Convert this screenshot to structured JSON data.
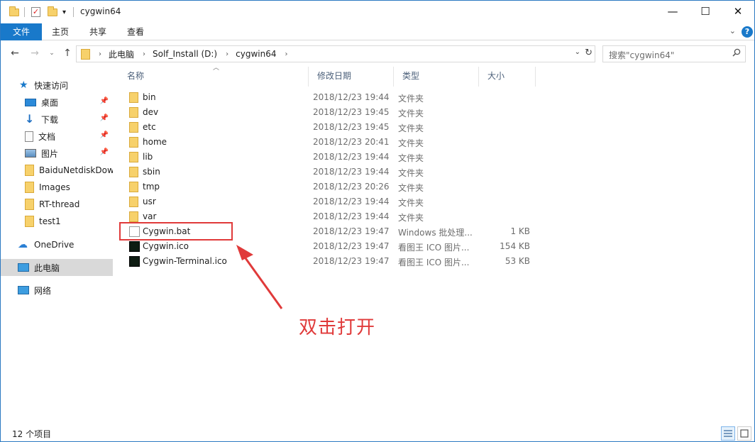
{
  "window": {
    "title": "cygwin64",
    "controls": {
      "minimize": "—",
      "maximize": "☐",
      "close": "✕"
    }
  },
  "ribbon": {
    "tabs": [
      "文件",
      "主页",
      "共享",
      "查看"
    ],
    "help": "?",
    "collapse": "⌄"
  },
  "address": {
    "crumbs": [
      "此电脑",
      "Solf_Install (D:)",
      "cygwin64"
    ],
    "search_placeholder": "搜索\"cygwin64\""
  },
  "navpane": {
    "quick_access": "快速访问",
    "pinned": [
      "桌面",
      "下载",
      "文档",
      "图片"
    ],
    "folders": [
      "BaiduNetdiskDownload",
      "Images",
      "RT-thread",
      "test1"
    ],
    "onedrive": "OneDrive",
    "this_pc": "此电脑",
    "network": "网络"
  },
  "columns": {
    "name": "名称",
    "date": "修改日期",
    "type": "类型",
    "size": "大小"
  },
  "files": [
    {
      "name": "bin",
      "date": "2018/12/23 19:44",
      "type": "文件夹",
      "size": "",
      "kind": "folder"
    },
    {
      "name": "dev",
      "date": "2018/12/23 19:45",
      "type": "文件夹",
      "size": "",
      "kind": "folder"
    },
    {
      "name": "etc",
      "date": "2018/12/23 19:45",
      "type": "文件夹",
      "size": "",
      "kind": "folder"
    },
    {
      "name": "home",
      "date": "2018/12/23 20:41",
      "type": "文件夹",
      "size": "",
      "kind": "folder"
    },
    {
      "name": "lib",
      "date": "2018/12/23 19:44",
      "type": "文件夹",
      "size": "",
      "kind": "folder"
    },
    {
      "name": "sbin",
      "date": "2018/12/23 19:44",
      "type": "文件夹",
      "size": "",
      "kind": "folder"
    },
    {
      "name": "tmp",
      "date": "2018/12/23 20:26",
      "type": "文件夹",
      "size": "",
      "kind": "folder"
    },
    {
      "name": "usr",
      "date": "2018/12/23 19:44",
      "type": "文件夹",
      "size": "",
      "kind": "folder"
    },
    {
      "name": "var",
      "date": "2018/12/23 19:44",
      "type": "文件夹",
      "size": "",
      "kind": "folder"
    },
    {
      "name": "Cygwin.bat",
      "date": "2018/12/23 19:47",
      "type": "Windows 批处理...",
      "size": "1 KB",
      "kind": "bat"
    },
    {
      "name": "Cygwin.ico",
      "date": "2018/12/23 19:47",
      "type": "看图王 ICO 图片...",
      "size": "154 KB",
      "kind": "ico"
    },
    {
      "name": "Cygwin-Terminal.ico",
      "date": "2018/12/23 19:47",
      "type": "看图王 ICO 图片...",
      "size": "53 KB",
      "kind": "ico"
    }
  ],
  "annotation": "双击打开",
  "status": {
    "count": "12 个项目"
  },
  "colors": {
    "accent": "#1979ca",
    "annotation": "#e03a3a",
    "folder": "#f7d16b"
  }
}
